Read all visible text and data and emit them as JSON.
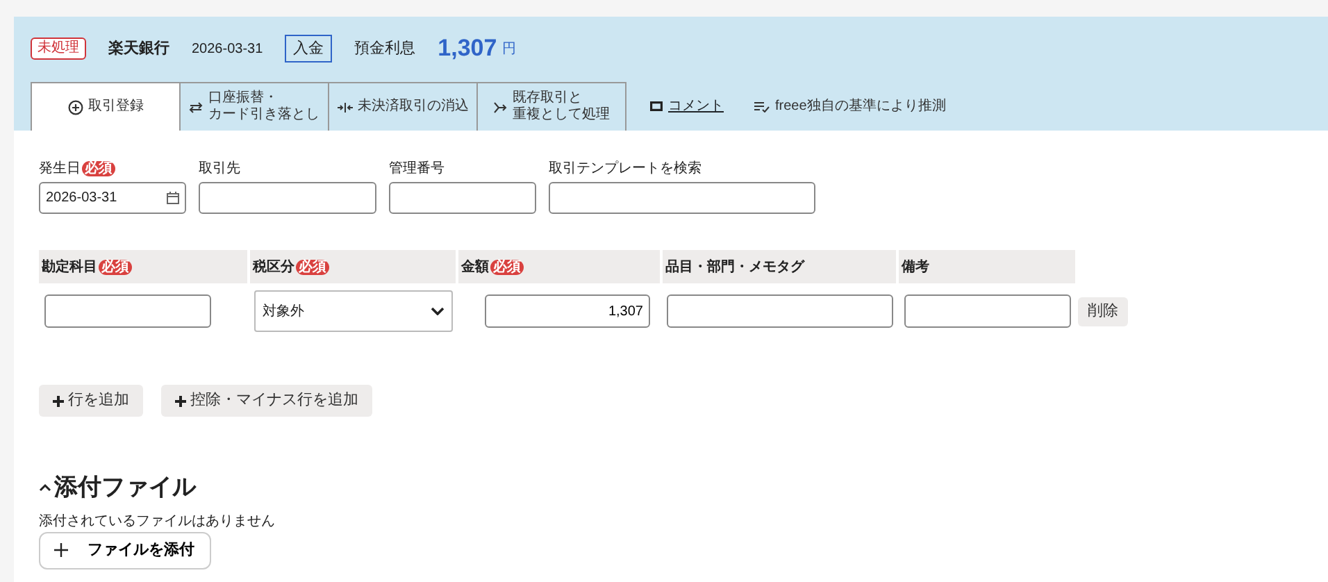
{
  "header": {
    "status": "未処理",
    "bank": "楽天銀行",
    "date": "2026-03-31",
    "direction": "入金",
    "description": "預金利息",
    "amount": "1,307",
    "currency": "円"
  },
  "tabs": [
    {
      "lines": [
        "取引登録"
      ],
      "selected": true
    },
    {
      "lines": [
        "口座振替・",
        "カード引き落とし"
      ],
      "selected": false
    },
    {
      "lines": [
        "未決済取引の消込"
      ],
      "selected": false
    },
    {
      "lines": [
        "既存取引と",
        "重複として処理"
      ],
      "selected": false
    }
  ],
  "comment_link": "コメント",
  "guess_note": "freee独自の基準により推測",
  "fields": [
    {
      "label": "発生日",
      "badge": "必須",
      "value": "2026-03-31",
      "kind": "date"
    },
    {
      "label": "取引先",
      "kind": "text"
    },
    {
      "label": "管理番号",
      "kind": "text"
    },
    {
      "label": "取引テンプレートを検索",
      "kind": "wide"
    }
  ],
  "table": {
    "columns": [
      {
        "label": "勘定科目",
        "badge": "必須"
      },
      {
        "label": "税区分",
        "badge": "必須"
      },
      {
        "label": "金額",
        "badge": "必須"
      },
      {
        "label": "品目・部門・メモタグ"
      },
      {
        "label": "備考"
      }
    ],
    "rows": [
      {
        "cells": [
          {
            "kind": "text"
          },
          {
            "kind": "select",
            "value": "対象外"
          },
          {
            "kind": "amount",
            "value": "1,307"
          },
          {
            "kind": "wide"
          },
          {
            "kind": "text"
          }
        ],
        "delete": "削除"
      }
    ]
  },
  "add_buttons": [
    "行を追加",
    "控除・マイナス行を追加"
  ],
  "attachments": {
    "heading": "添付ファイル",
    "expanded": true,
    "empty_text": "添付されているファイルはありません",
    "button": "ファイルを添付"
  }
}
